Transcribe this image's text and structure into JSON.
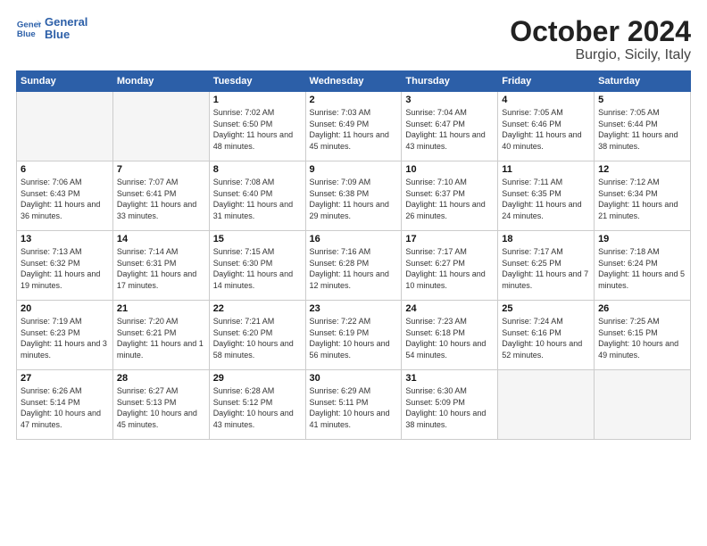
{
  "header": {
    "logo_line1": "General",
    "logo_line2": "Blue",
    "month": "October 2024",
    "location": "Burgio, Sicily, Italy"
  },
  "days_of_week": [
    "Sunday",
    "Monday",
    "Tuesday",
    "Wednesday",
    "Thursday",
    "Friday",
    "Saturday"
  ],
  "weeks": [
    [
      {
        "num": "",
        "empty": true
      },
      {
        "num": "",
        "empty": true
      },
      {
        "num": "1",
        "sunrise": "Sunrise: 7:02 AM",
        "sunset": "Sunset: 6:50 PM",
        "daylight": "Daylight: 11 hours and 48 minutes."
      },
      {
        "num": "2",
        "sunrise": "Sunrise: 7:03 AM",
        "sunset": "Sunset: 6:49 PM",
        "daylight": "Daylight: 11 hours and 45 minutes."
      },
      {
        "num": "3",
        "sunrise": "Sunrise: 7:04 AM",
        "sunset": "Sunset: 6:47 PM",
        "daylight": "Daylight: 11 hours and 43 minutes."
      },
      {
        "num": "4",
        "sunrise": "Sunrise: 7:05 AM",
        "sunset": "Sunset: 6:46 PM",
        "daylight": "Daylight: 11 hours and 40 minutes."
      },
      {
        "num": "5",
        "sunrise": "Sunrise: 7:05 AM",
        "sunset": "Sunset: 6:44 PM",
        "daylight": "Daylight: 11 hours and 38 minutes."
      }
    ],
    [
      {
        "num": "6",
        "sunrise": "Sunrise: 7:06 AM",
        "sunset": "Sunset: 6:43 PM",
        "daylight": "Daylight: 11 hours and 36 minutes."
      },
      {
        "num": "7",
        "sunrise": "Sunrise: 7:07 AM",
        "sunset": "Sunset: 6:41 PM",
        "daylight": "Daylight: 11 hours and 33 minutes."
      },
      {
        "num": "8",
        "sunrise": "Sunrise: 7:08 AM",
        "sunset": "Sunset: 6:40 PM",
        "daylight": "Daylight: 11 hours and 31 minutes."
      },
      {
        "num": "9",
        "sunrise": "Sunrise: 7:09 AM",
        "sunset": "Sunset: 6:38 PM",
        "daylight": "Daylight: 11 hours and 29 minutes."
      },
      {
        "num": "10",
        "sunrise": "Sunrise: 7:10 AM",
        "sunset": "Sunset: 6:37 PM",
        "daylight": "Daylight: 11 hours and 26 minutes."
      },
      {
        "num": "11",
        "sunrise": "Sunrise: 7:11 AM",
        "sunset": "Sunset: 6:35 PM",
        "daylight": "Daylight: 11 hours and 24 minutes."
      },
      {
        "num": "12",
        "sunrise": "Sunrise: 7:12 AM",
        "sunset": "Sunset: 6:34 PM",
        "daylight": "Daylight: 11 hours and 21 minutes."
      }
    ],
    [
      {
        "num": "13",
        "sunrise": "Sunrise: 7:13 AM",
        "sunset": "Sunset: 6:32 PM",
        "daylight": "Daylight: 11 hours and 19 minutes."
      },
      {
        "num": "14",
        "sunrise": "Sunrise: 7:14 AM",
        "sunset": "Sunset: 6:31 PM",
        "daylight": "Daylight: 11 hours and 17 minutes."
      },
      {
        "num": "15",
        "sunrise": "Sunrise: 7:15 AM",
        "sunset": "Sunset: 6:30 PM",
        "daylight": "Daylight: 11 hours and 14 minutes."
      },
      {
        "num": "16",
        "sunrise": "Sunrise: 7:16 AM",
        "sunset": "Sunset: 6:28 PM",
        "daylight": "Daylight: 11 hours and 12 minutes."
      },
      {
        "num": "17",
        "sunrise": "Sunrise: 7:17 AM",
        "sunset": "Sunset: 6:27 PM",
        "daylight": "Daylight: 11 hours and 10 minutes."
      },
      {
        "num": "18",
        "sunrise": "Sunrise: 7:17 AM",
        "sunset": "Sunset: 6:25 PM",
        "daylight": "Daylight: 11 hours and 7 minutes."
      },
      {
        "num": "19",
        "sunrise": "Sunrise: 7:18 AM",
        "sunset": "Sunset: 6:24 PM",
        "daylight": "Daylight: 11 hours and 5 minutes."
      }
    ],
    [
      {
        "num": "20",
        "sunrise": "Sunrise: 7:19 AM",
        "sunset": "Sunset: 6:23 PM",
        "daylight": "Daylight: 11 hours and 3 minutes."
      },
      {
        "num": "21",
        "sunrise": "Sunrise: 7:20 AM",
        "sunset": "Sunset: 6:21 PM",
        "daylight": "Daylight: 11 hours and 1 minute."
      },
      {
        "num": "22",
        "sunrise": "Sunrise: 7:21 AM",
        "sunset": "Sunset: 6:20 PM",
        "daylight": "Daylight: 10 hours and 58 minutes."
      },
      {
        "num": "23",
        "sunrise": "Sunrise: 7:22 AM",
        "sunset": "Sunset: 6:19 PM",
        "daylight": "Daylight: 10 hours and 56 minutes."
      },
      {
        "num": "24",
        "sunrise": "Sunrise: 7:23 AM",
        "sunset": "Sunset: 6:18 PM",
        "daylight": "Daylight: 10 hours and 54 minutes."
      },
      {
        "num": "25",
        "sunrise": "Sunrise: 7:24 AM",
        "sunset": "Sunset: 6:16 PM",
        "daylight": "Daylight: 10 hours and 52 minutes."
      },
      {
        "num": "26",
        "sunrise": "Sunrise: 7:25 AM",
        "sunset": "Sunset: 6:15 PM",
        "daylight": "Daylight: 10 hours and 49 minutes."
      }
    ],
    [
      {
        "num": "27",
        "sunrise": "Sunrise: 6:26 AM",
        "sunset": "Sunset: 5:14 PM",
        "daylight": "Daylight: 10 hours and 47 minutes."
      },
      {
        "num": "28",
        "sunrise": "Sunrise: 6:27 AM",
        "sunset": "Sunset: 5:13 PM",
        "daylight": "Daylight: 10 hours and 45 minutes."
      },
      {
        "num": "29",
        "sunrise": "Sunrise: 6:28 AM",
        "sunset": "Sunset: 5:12 PM",
        "daylight": "Daylight: 10 hours and 43 minutes."
      },
      {
        "num": "30",
        "sunrise": "Sunrise: 6:29 AM",
        "sunset": "Sunset: 5:11 PM",
        "daylight": "Daylight: 10 hours and 41 minutes."
      },
      {
        "num": "31",
        "sunrise": "Sunrise: 6:30 AM",
        "sunset": "Sunset: 5:09 PM",
        "daylight": "Daylight: 10 hours and 38 minutes."
      },
      {
        "num": "",
        "empty": true
      },
      {
        "num": "",
        "empty": true
      }
    ]
  ]
}
